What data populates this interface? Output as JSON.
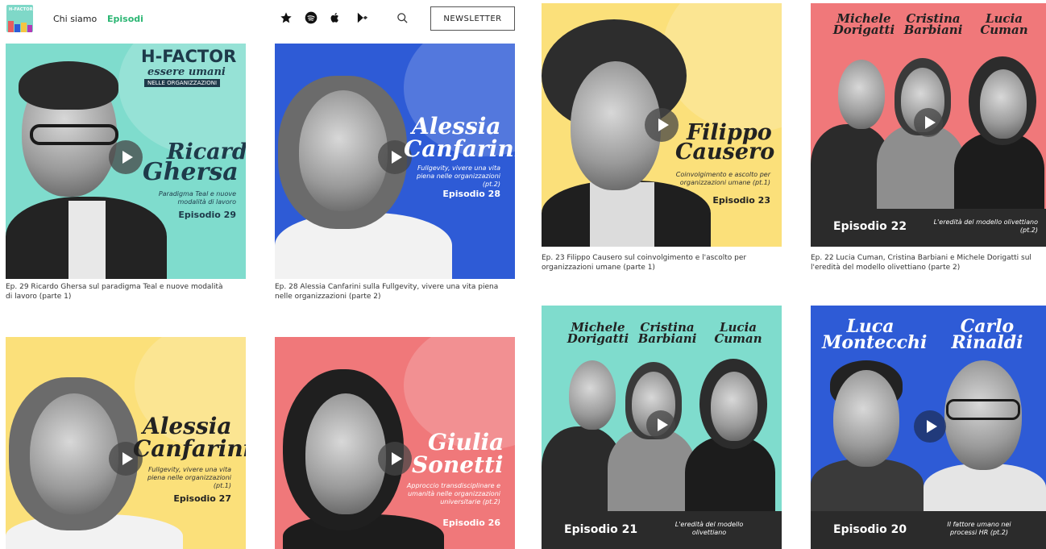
{
  "header": {
    "logo_text": "H-FACTOR",
    "nav": {
      "chi_siamo": "Chi siamo",
      "episodi": "Episodi"
    },
    "newsletter_label": "NEWSLETTER",
    "icons": [
      "star-icon",
      "spotify-icon",
      "apple-icon",
      "google-play-icon",
      "search-icon"
    ]
  },
  "colors": {
    "teal": "#7fdccd",
    "blue": "#2e5bd6",
    "yellow": "#fbe07a",
    "pink": "#f0787a",
    "active_nav": "#2bb673"
  },
  "episodes": [
    {
      "brand_line1": "H-FACTOR",
      "brand_line2": "essere umani",
      "brand_line3": "NELLE ORGANIZZAZIONI",
      "name1": "Ricardo",
      "name2": "Ghersa",
      "subtitle": "Paradigma Teal e nuove modalità di lavoro",
      "episode": "Episodio 29",
      "caption": "Ep. 29 Ricardo Ghersa sul paradigma Teal e nuove modalità di lavoro (parte 1)"
    },
    {
      "name1": "Alessia",
      "name2": "Canfarini",
      "subtitle": "Fullgevity, vivere una vita piena nelle organizzazioni (pt.2)",
      "episode": "Episodio 28",
      "caption": "Ep. 28 Alessia Canfarini sulla Fullgevity, vivere una vita piena nelle organizzazioni (parte 2)"
    },
    {
      "name1": "Filippo",
      "name2": "Causero",
      "subtitle": "Coinvolgimento e ascolto per organizzazioni umane (pt.1)",
      "episode": "Episodio 23",
      "caption": "Ep. 23 Filippo Causero sul coinvolgimento e l'ascolto per organizzazioni umane (parte 1)"
    },
    {
      "names": [
        "Michele Dorigatti",
        "Cristina Barbiani",
        "Lucia Cuman"
      ],
      "subtitle": "L'eredità del modello olivettiano (pt.2)",
      "episode": "Episodio 22",
      "caption": "Ep. 22 Lucia Cuman, Cristina Barbiani e Michele Dorigatti sul l'eredità del modello olivettiano (parte 2)"
    },
    {
      "name1": "Alessia",
      "name2": "Canfarini",
      "subtitle": "Fullgevity, vivere una vita piena nelle organizzazioni (pt.1)",
      "episode": "Episodio 27"
    },
    {
      "name1": "Giulia",
      "name2": "Sonetti",
      "subtitle": "Approccio transdisciplinare e umanità nelle organizzazioni universitarie (pt.2)",
      "episode": "Episodio 26"
    },
    {
      "names": [
        "Michele Dorigatti",
        "Cristina Barbiani",
        "Lucia Cuman"
      ],
      "subtitle": "L'eredità del modello olivettiano",
      "episode": "Episodio 21"
    },
    {
      "names": [
        "Luca Montecchi",
        "Carlo Rinaldi"
      ],
      "subtitle": "Il fattore umano nei processi HR (pt.2)",
      "episode": "Episodio 20"
    }
  ]
}
